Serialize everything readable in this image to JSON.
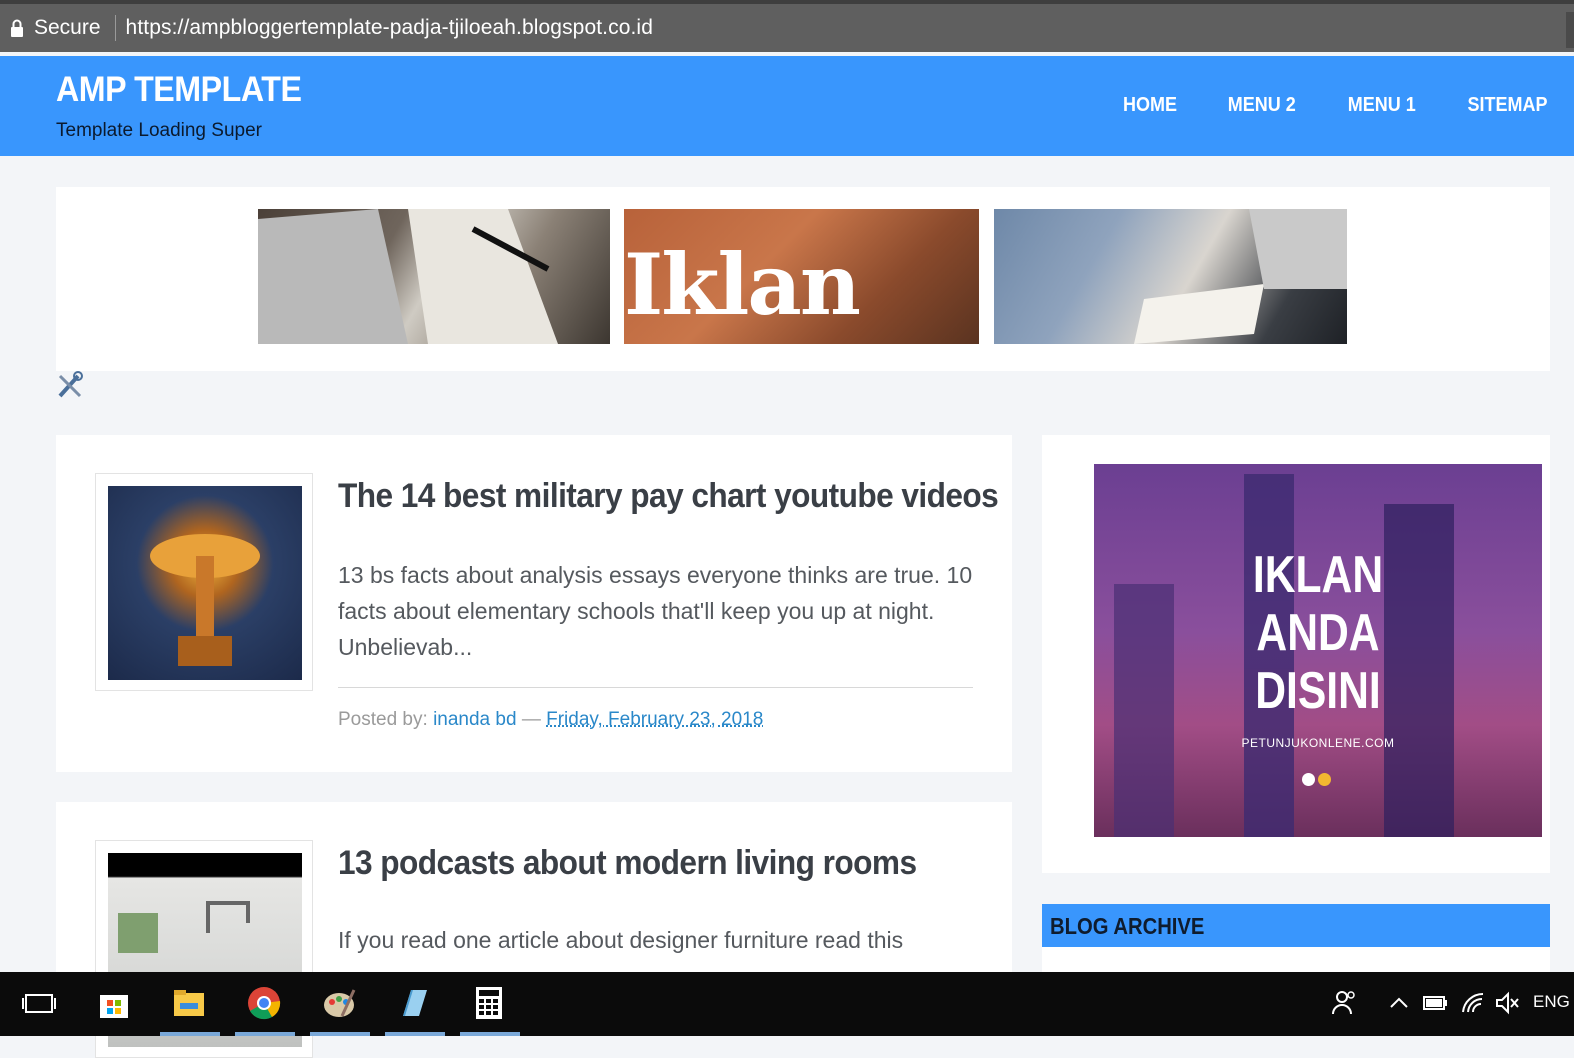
{
  "browser": {
    "secure_label": "Secure",
    "url": "https://ampbloggertemplate-padja-tjiloeah.blogspot.co.id"
  },
  "header": {
    "title": "AMP TEMPLATE",
    "tagline": "Template Loading Super",
    "nav": [
      "HOME",
      "MENU 2",
      "MENU 1",
      "SITEMAP"
    ]
  },
  "banner": {
    "ad_text": "Iklan"
  },
  "posts": [
    {
      "title": "The 14 best military pay chart youtube videos",
      "excerpt": "13 bs facts about analysis essays everyone thinks are true. 10 facts about elementary schools that'll keep you up at night. Unbelievab...",
      "posted_by_label": "Posted by:",
      "author": "inanda bd",
      "separator": "—",
      "date": "Friday, February 23, 2018"
    },
    {
      "title": "13 podcasts about modern living rooms",
      "excerpt": "If you read one article about designer furniture read this"
    }
  ],
  "sidebar": {
    "ad_line1": "IKLAN",
    "ad_line2": "ANDA",
    "ad_line3": "DISINI",
    "ad_site": "PETUNJUKONLENE.COM",
    "archive_title": "BLOG ARCHIVE"
  },
  "taskbar": {
    "language": "ENG",
    "icons": [
      "task-view-icon",
      "store-icon",
      "file-explorer-icon",
      "chrome-icon",
      "paint-icon",
      "notepad-icon",
      "calculator-icon"
    ],
    "tray_icons": [
      "people-icon",
      "chevron-up-icon",
      "battery-icon",
      "wifi-icon",
      "volume-muted-icon"
    ]
  },
  "colors": {
    "header_blue": "#3996fd",
    "link_blue": "#2a88c9",
    "page_bg": "#f3f5f8"
  }
}
